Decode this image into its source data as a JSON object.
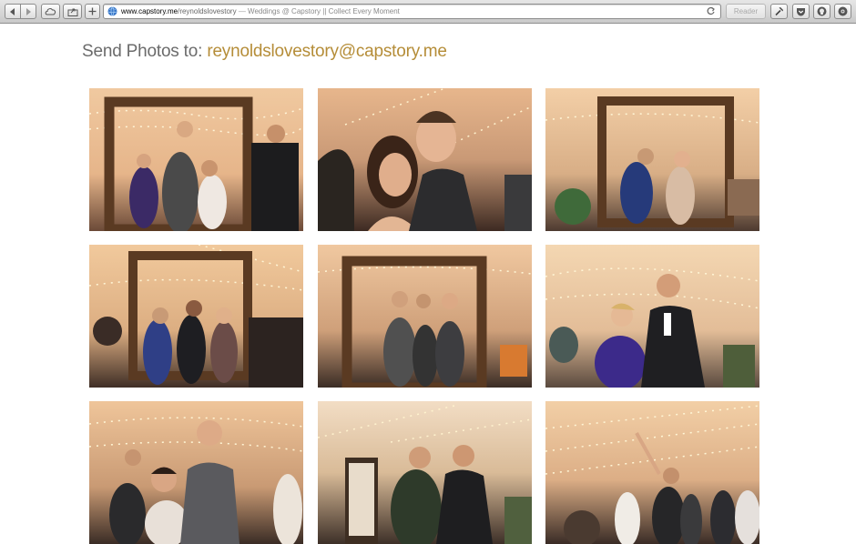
{
  "browser": {
    "url_host": "www.capstory.me",
    "url_path": "/reynoldslovestory",
    "url_separator": "—",
    "page_title": "Weddings @ Capstory || Collect Every Moment",
    "reader_label": "Reader"
  },
  "header": {
    "prefix": "Send Photos to:",
    "email": "reynoldslovestory@capstory.me"
  },
  "photos": [
    {
      "subject": "wedding guests posing in wooden picture frame"
    },
    {
      "subject": "couple smiling at wedding reception"
    },
    {
      "subject": "two women posing in wooden picture frame"
    },
    {
      "subject": "three women posing in wooden picture frame"
    },
    {
      "subject": "group of men posing in wooden picture frame"
    },
    {
      "subject": "man and woman posing under tent lights"
    },
    {
      "subject": "guests smiling at reception"
    },
    {
      "subject": "two men posing in front of love sign"
    },
    {
      "subject": "guests dancing under tent lights"
    }
  ],
  "colors": {
    "email_accent": "#b58d38",
    "header_text": "#6b6b6b",
    "tent_light": "#f6d9a8",
    "frame_wood": "#5a3a22"
  }
}
